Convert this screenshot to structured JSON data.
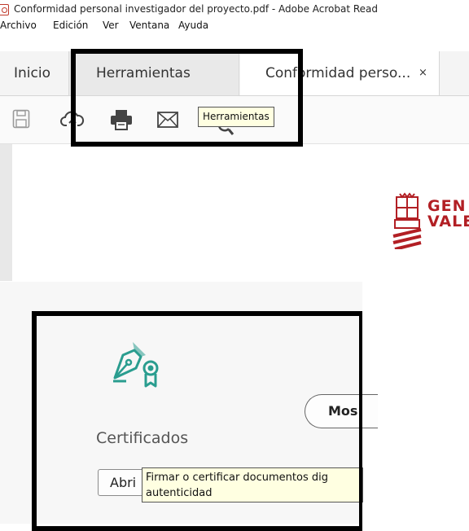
{
  "window": {
    "title": "Conformidad personal investigador del proyecto.pdf - Adobe Acrobat Read"
  },
  "menu": [
    "Archivo",
    "Edición",
    "Ver",
    "Ventana",
    "Ayuda"
  ],
  "tabs": {
    "home": "Inicio",
    "tools": "Herramientas",
    "document": "Conformidad perso...",
    "close_glyph": "×"
  },
  "toolbar": {
    "tooltip": "Herramientas",
    "icons": [
      "save-icon",
      "cloud-upload-icon",
      "print-icon",
      "email-icon",
      "search-icon"
    ]
  },
  "document": {
    "logo_line1": "GEN",
    "logo_line2": "VALE"
  },
  "tools_pane": {
    "card_title": "Certificados",
    "open_button": "Abri",
    "show_more_button": "Mos",
    "tooltip_line1": "Firmar o certificar documentos dig",
    "tooltip_line2": "autenticidad"
  },
  "colors": {
    "highlight_border": "#000000",
    "tooltip_bg": "#ffffe1",
    "brand_red": "#b21f24",
    "cert_icon_teal": "#2a9d8f"
  }
}
